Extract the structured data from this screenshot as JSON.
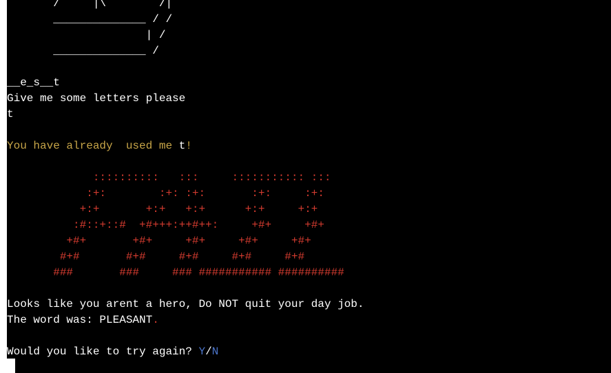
{
  "hangman_art": [
    "       /     |\\        /|",
    "       ______________ / /",
    "                     | /",
    "       ______________ /"
  ],
  "word_progress": "__e_s__t",
  "prompt": "Give me some letters please",
  "user_input": "t",
  "already_used": {
    "message": "You have already  used me ",
    "letter": "t",
    "suffix": "!"
  },
  "lose_banner": [
    "             ::::::::::   :::     ::::::::::: :::",
    "            :+:        :+: :+:       :+:     :+:",
    "           +:+       +:+   +:+      +:+     +:+",
    "          :#::+::#  +#+++:++#++:     +#+     +#+",
    "         +#+       +#+     +#+     +#+     +#+",
    "        #+#       #+#     #+#     #+#     #+#",
    "       ###       ###     ### ########### ##########"
  ],
  "lose_message": "Looks like you arent a hero, Do NOT quit your day job.",
  "word_reveal": {
    "label": "The word was: PLEASANT",
    "dot": "."
  },
  "replay": {
    "question": "Would you like to try again? ",
    "yes": "Y",
    "sep": "/",
    "no": "N"
  },
  "colors": {
    "background": "#000000",
    "text": "#ffffff",
    "warning": "#c7a548",
    "banner": "#d33b2f",
    "option": "#4b74c9"
  }
}
